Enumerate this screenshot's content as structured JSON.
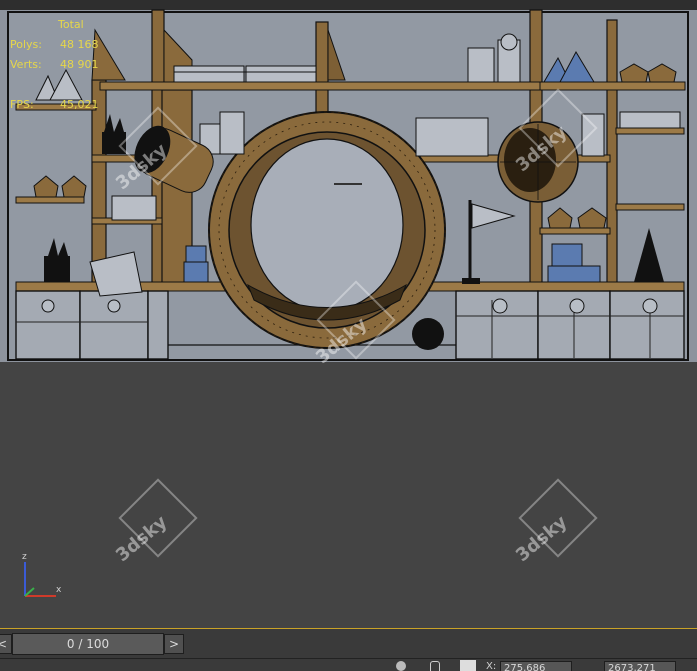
{
  "stats": {
    "total_header": "Total",
    "polys_label": "Polys:",
    "polys_value": "48 168",
    "verts_label": "Verts:",
    "verts_value": "48 901",
    "fps_label": "FPS:",
    "fps_value": "45,021"
  },
  "watermark": "3dsky",
  "gizmo": {
    "z": "z",
    "x": "x"
  },
  "timeline": {
    "prev": "<",
    "position": "0 / 100",
    "next": ">"
  },
  "status": {
    "x_label": "X:",
    "x_value": "275,686",
    "y_value": "2673,271"
  },
  "colors": {
    "viewport_bg": "#444444",
    "scene_bg": "#8e949e",
    "wood": "#8a6a3c",
    "stats_text": "#e6d74a",
    "timebar_accent": "#c9a227"
  }
}
